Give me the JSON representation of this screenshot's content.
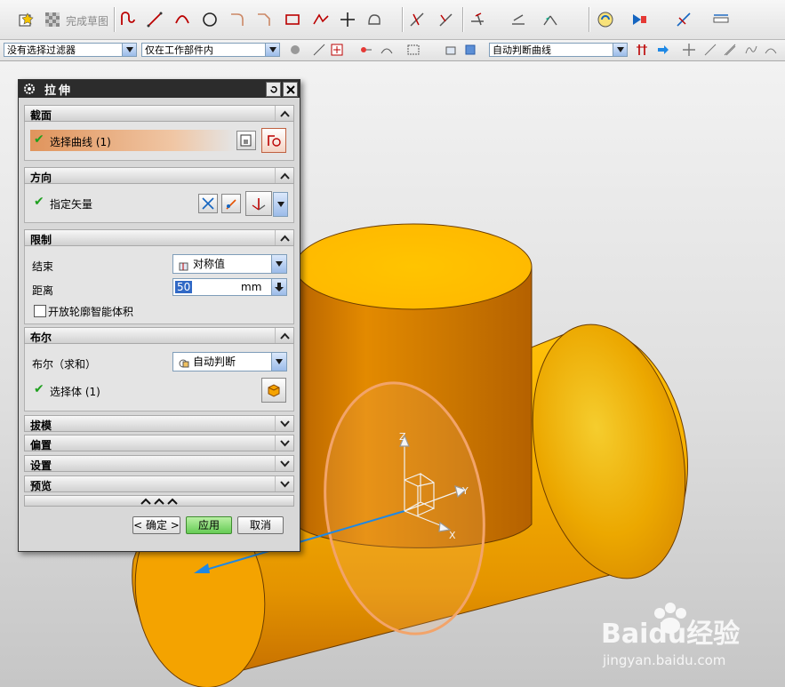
{
  "toolbar": {
    "finish_sketch_label": "完成草图"
  },
  "filters": {
    "selection_filter": "没有选择过滤器",
    "scope": "仅在工作部件内",
    "curve_rule": "自动判断曲线"
  },
  "dialog": {
    "title": "拉伸",
    "section": {
      "header": "截面",
      "select_curve_label": "选择曲线 (1)"
    },
    "direction": {
      "header": "方向",
      "vector_label": "指定矢量"
    },
    "limits": {
      "header": "限制",
      "end_label": "结束",
      "end_value": "对称值",
      "distance_label": "距离",
      "distance_value": "50",
      "distance_unit": "mm",
      "open_profile_label": "开放轮廓智能体积"
    },
    "boolean": {
      "header": "布尔",
      "boolean_label": "布尔（求和）",
      "boolean_value": "自动判断",
      "select_body_label": "选择体 (1)"
    },
    "draft_header": "拔模",
    "offset_header": "偏置",
    "settings_header": "设置",
    "preview_header": "预览",
    "ok_label": "< 确定 >",
    "apply_label": "应用",
    "cancel_label": "取消"
  },
  "axes": {
    "z": "Z",
    "y": "Y",
    "x": "X"
  },
  "watermark": {
    "brand": "Baidu经验",
    "url": "jingyan.baidu.com"
  },
  "colors": {
    "solid_orange": "#f0a800",
    "dialog_title_bg": "#2c2c2c",
    "preview_circle": "#f2a46a",
    "vector_blue": "#1e88e5"
  }
}
